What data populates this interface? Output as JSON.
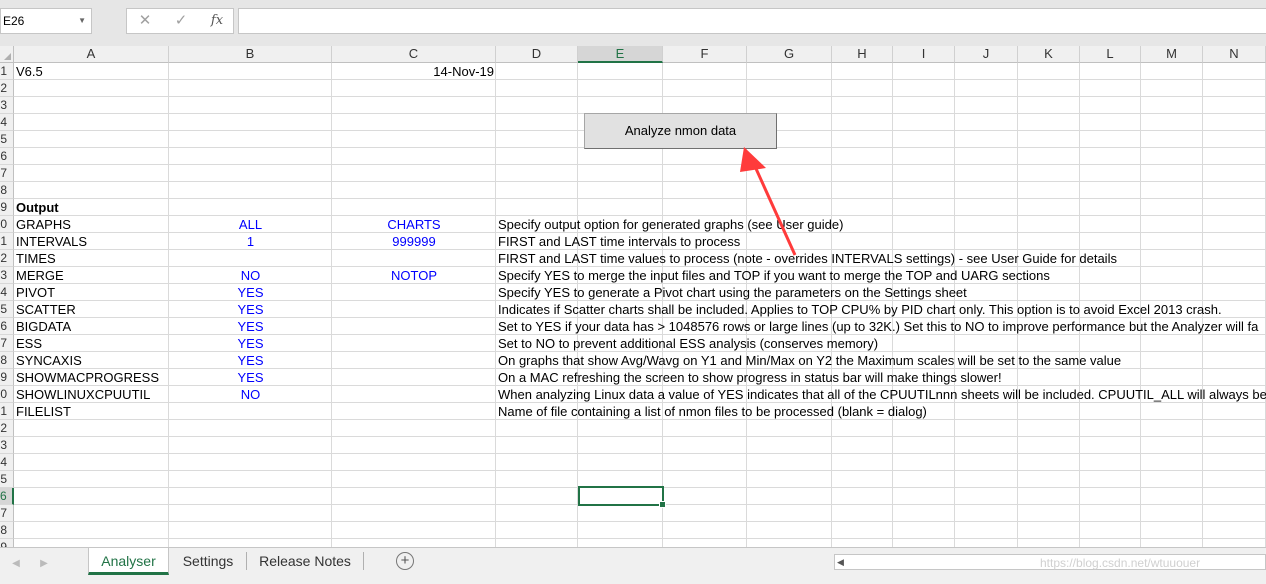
{
  "formula_bar": {
    "name_box": "E26",
    "cancel_glyph": "✕",
    "enter_glyph": "✓",
    "fx_label": "fx",
    "formula_value": ""
  },
  "columns": [
    "A",
    "B",
    "C",
    "D",
    "E",
    "F",
    "G",
    "H",
    "I",
    "J",
    "K",
    "L",
    "M",
    "N"
  ],
  "selected_column": "E",
  "rows": [
    "1",
    "2",
    "3",
    "4",
    "5",
    "6",
    "7",
    "8",
    "9",
    "0",
    "1",
    "2",
    "3",
    "4",
    "5",
    "6",
    "7",
    "8",
    "9",
    "0",
    "1",
    "2",
    "3",
    "4",
    "5",
    "6",
    "7",
    "8",
    "9"
  ],
  "selected_row_index": 25,
  "cells": {
    "a1": "V6.5",
    "c1": "14-Nov-19",
    "a9": "Output",
    "a10": "GRAPHS",
    "b10": "ALL",
    "c10": "CHARTS",
    "d10": "Specify output option for generated graphs (see User guide)",
    "a11": "INTERVALS",
    "b11": "1",
    "c11": "999999",
    "d11": "FIRST and LAST time intervals to process",
    "a12": "TIMES",
    "d12": "FIRST and LAST time values to process (note - overrides INTERVALS settings) - see User Guide for details",
    "a13": "MERGE",
    "b13": "NO",
    "c13": "NOTOP",
    "d13": "Specify YES to merge the input files and TOP if you want to merge the TOP and UARG sections",
    "a14": "PIVOT",
    "b14": "YES",
    "d14": "Specify YES to generate a Pivot chart using the parameters on the Settings sheet",
    "a15": "SCATTER",
    "b15": "YES",
    "d15": "Indicates if Scatter charts shall be included.  Applies to TOP CPU% by PID chart only.  This option is to avoid Excel 2013 crash.",
    "a16": "BIGDATA",
    "b16": "YES",
    "d16": "Set to YES if your data has > 1048576 rows or large lines (up to 32K.)  Set this to NO to improve performance but the Analyzer will fa",
    "a17": "ESS",
    "b17": "YES",
    "d17": "Set to NO to prevent additional ESS analysis (conserves memory)",
    "a18": "SYNCAXIS",
    "b18": "YES",
    "d18": "On graphs that show Avg/Wavg on Y1 and Min/Max on Y2 the Maximum scales will be set to the same value",
    "a19": "SHOWMACPROGRESS",
    "b19": "YES",
    "d19": "On a MAC refreshing the screen to show progress in status bar will make things slower!",
    "a20": "SHOWLINUXCPUUTIL",
    "b20": "NO",
    "d20": "When analyzing Linux data a value of YES indicates that all of the CPUUTILnnn sheets will be included.  CPUUTIL_ALL will always be",
    "a21": "FILELIST",
    "d21": "Name of file containing a list of nmon files to be processed (blank = dialog)"
  },
  "macro_button": {
    "label": "Analyze nmon data"
  },
  "annotation": {
    "color": "#ff3b3b"
  },
  "sheet_tabs": [
    {
      "label": "Analyser",
      "active": true
    },
    {
      "label": "Settings",
      "active": false
    },
    {
      "label": "Release Notes",
      "active": false
    }
  ],
  "add_sheet_glyph": "+",
  "nav_prev_glyph": "◀",
  "nav_next_glyph": "▶",
  "scroll_left_glyph": "◀",
  "watermark": "https://blog.csdn.net/wtuuouer",
  "accent_color": "#217346"
}
